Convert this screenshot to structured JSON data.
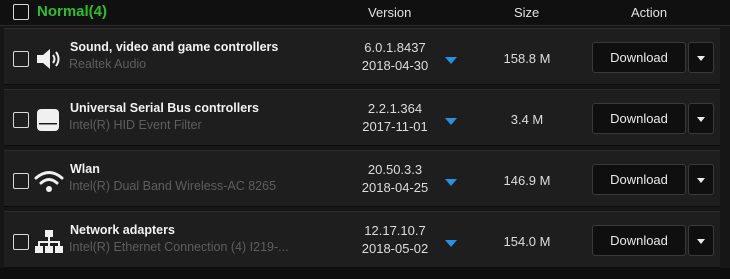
{
  "group": {
    "title": "Normal(4)"
  },
  "columns": {
    "version": "Version",
    "size": "Size",
    "action": "Action"
  },
  "rows": [
    {
      "name": "Sound, video and game controllers",
      "sub": "Realtek Audio",
      "version": "6.0.1.8437",
      "date": "2018-04-30",
      "size": "158.8 M",
      "action": "Download",
      "icon": "speaker-icon"
    },
    {
      "name": "Universal Serial Bus controllers",
      "sub": "Intel(R) HID Event Filter",
      "version": "2.2.1.364",
      "date": "2017-11-01",
      "size": "3.4 M",
      "action": "Download",
      "icon": "drive-icon"
    },
    {
      "name": "Wlan",
      "sub": "Intel(R) Dual Band Wireless-AC 8265",
      "version": "20.50.3.3",
      "date": "2018-04-25",
      "size": "146.9 M",
      "action": "Download",
      "icon": "wifi-icon"
    },
    {
      "name": "Network adapters",
      "sub": "Intel(R) Ethernet Connection (4) I219-...",
      "version": "12.17.10.7",
      "date": "2018-05-02",
      "size": "154.0 M",
      "action": "Download",
      "icon": "network-icon"
    }
  ],
  "colors": {
    "group_title": "#2fbe2f",
    "arrow": "#2d8fe0",
    "background": "#161616"
  }
}
